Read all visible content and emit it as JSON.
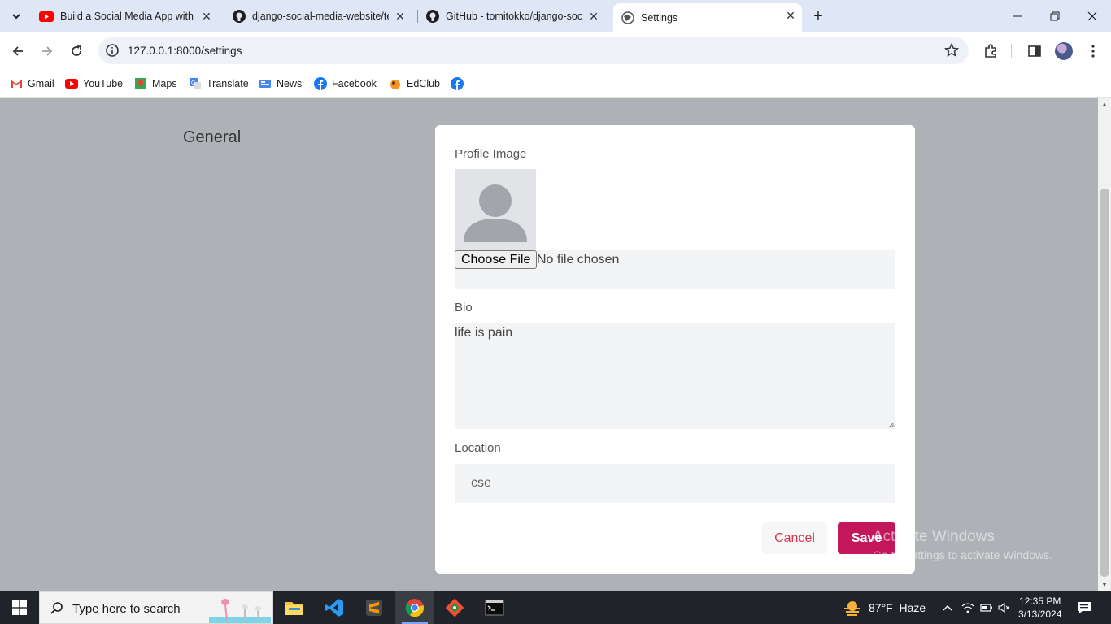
{
  "browser": {
    "tabs": [
      {
        "title": "Build a Social Media App with D",
        "icon": "youtube-icon"
      },
      {
        "title": "django-social-media-website/te",
        "icon": "github-icon"
      },
      {
        "title": "GitHub - tomitokko/django-soc",
        "icon": "github-icon"
      },
      {
        "title": "Settings",
        "icon": "globe-icon"
      }
    ],
    "url": "127.0.0.1:8000/settings",
    "bookmarks": [
      "Gmail",
      "YouTube",
      "Maps",
      "Translate",
      "News",
      "Facebook",
      "EdClub"
    ]
  },
  "page": {
    "section_title": "General",
    "profile_image_label": "Profile Image",
    "choose_file_label": "Choose File",
    "no_file_text": "No file chosen",
    "bio_label": "Bio",
    "bio_value": "life is pain",
    "location_label": "Location",
    "location_value": "cse",
    "cancel_label": "Cancel",
    "save_label": "Save",
    "accent_color": "#c2185b",
    "cancel_color": "#d9364d"
  },
  "watermark": {
    "line1": "Activate Windows",
    "line2": "Go to Settings to activate Windows."
  },
  "taskbar": {
    "search_placeholder": "Type here to search",
    "weather": "87°F  Haze",
    "time": "12:35 PM",
    "date": "3/13/2024"
  }
}
